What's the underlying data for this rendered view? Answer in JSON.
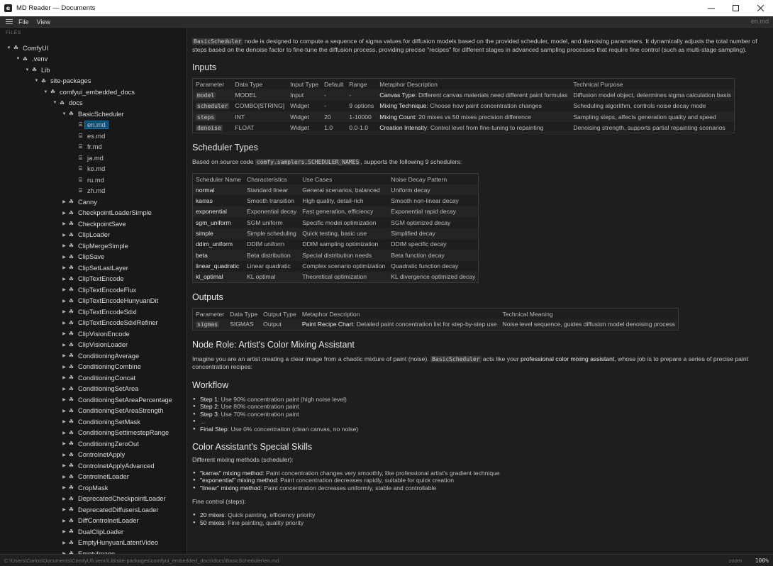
{
  "window": {
    "title": "MD Reader — Documents",
    "app_icon": "reader-app-icon"
  },
  "menu": {
    "items": [
      "File",
      "View"
    ],
    "right_label": "en.md"
  },
  "sidebar": {
    "header": "FILES",
    "tree": [
      {
        "label": "ComfyUI",
        "depth": 0,
        "type": "folder",
        "expanded": true
      },
      {
        "label": ".venv",
        "depth": 1,
        "type": "folder",
        "expanded": true
      },
      {
        "label": "Lib",
        "depth": 2,
        "type": "folder",
        "expanded": true
      },
      {
        "label": "site-packages",
        "depth": 3,
        "type": "folder",
        "expanded": true
      },
      {
        "label": "comfyui_embedded_docs",
        "depth": 4,
        "type": "folder",
        "expanded": true
      },
      {
        "label": "docs",
        "depth": 5,
        "type": "folder",
        "expanded": true
      },
      {
        "label": "BasicScheduler",
        "depth": 6,
        "type": "folder",
        "expanded": true
      },
      {
        "label": "en.md",
        "depth": 7,
        "type": "file",
        "selected": true
      },
      {
        "label": "es.md",
        "depth": 7,
        "type": "file"
      },
      {
        "label": "fr.md",
        "depth": 7,
        "type": "file"
      },
      {
        "label": "ja.md",
        "depth": 7,
        "type": "file"
      },
      {
        "label": "ko.md",
        "depth": 7,
        "type": "file"
      },
      {
        "label": "ru.md",
        "depth": 7,
        "type": "file"
      },
      {
        "label": "zh.md",
        "depth": 7,
        "type": "file"
      },
      {
        "label": "Canny",
        "depth": 6,
        "type": "folder"
      },
      {
        "label": "CheckpointLoaderSimple",
        "depth": 6,
        "type": "folder"
      },
      {
        "label": "CheckpointSave",
        "depth": 6,
        "type": "folder"
      },
      {
        "label": "ClipLoader",
        "depth": 6,
        "type": "folder"
      },
      {
        "label": "ClipMergeSimple",
        "depth": 6,
        "type": "folder"
      },
      {
        "label": "ClipSave",
        "depth": 6,
        "type": "folder"
      },
      {
        "label": "ClipSetLastLayer",
        "depth": 6,
        "type": "folder"
      },
      {
        "label": "ClipTextEncode",
        "depth": 6,
        "type": "folder"
      },
      {
        "label": "ClipTextEncodeFlux",
        "depth": 6,
        "type": "folder"
      },
      {
        "label": "ClipTextEncodeHunyuanDit",
        "depth": 6,
        "type": "folder"
      },
      {
        "label": "ClipTextEncodeSdxl",
        "depth": 6,
        "type": "folder"
      },
      {
        "label": "ClipTextEncodeSdxlRefiner",
        "depth": 6,
        "type": "folder"
      },
      {
        "label": "ClipVisionEncode",
        "depth": 6,
        "type": "folder"
      },
      {
        "label": "ClipVisionLoader",
        "depth": 6,
        "type": "folder"
      },
      {
        "label": "ConditioningAverage",
        "depth": 6,
        "type": "folder"
      },
      {
        "label": "ConditioningCombine",
        "depth": 6,
        "type": "folder"
      },
      {
        "label": "ConditioningConcat",
        "depth": 6,
        "type": "folder"
      },
      {
        "label": "ConditioningSetArea",
        "depth": 6,
        "type": "folder"
      },
      {
        "label": "ConditioningSetAreaPercentage",
        "depth": 6,
        "type": "folder"
      },
      {
        "label": "ConditioningSetAreaStrength",
        "depth": 6,
        "type": "folder"
      },
      {
        "label": "ConditioningSetMask",
        "depth": 6,
        "type": "folder"
      },
      {
        "label": "ConditioningSettimestepRange",
        "depth": 6,
        "type": "folder"
      },
      {
        "label": "ConditioningZeroOut",
        "depth": 6,
        "type": "folder"
      },
      {
        "label": "ControlnetApply",
        "depth": 6,
        "type": "folder"
      },
      {
        "label": "ControlnetApplyAdvanced",
        "depth": 6,
        "type": "folder"
      },
      {
        "label": "ControlnetLoader",
        "depth": 6,
        "type": "folder"
      },
      {
        "label": "CropMask",
        "depth": 6,
        "type": "folder"
      },
      {
        "label": "DeprecatedCheckpointLoader",
        "depth": 6,
        "type": "folder"
      },
      {
        "label": "DeprecatedDiffusersLoader",
        "depth": 6,
        "type": "folder"
      },
      {
        "label": "DiffControlnetLoader",
        "depth": 6,
        "type": "folder"
      },
      {
        "label": "DualClipLoader",
        "depth": 6,
        "type": "folder"
      },
      {
        "label": "EmptyHunyuanLatentVideo",
        "depth": 6,
        "type": "folder"
      },
      {
        "label": "EmptyImage",
        "depth": 6,
        "type": "folder"
      }
    ]
  },
  "status": {
    "path": "C:\\Users\\Carlos\\Documents\\ComfyUI\\.venv\\Lib\\site-packages\\comfyui_embedded_docs\\docs\\BasicScheduler\\en.md",
    "zoom_label": "zoom",
    "zoom": "100%"
  },
  "doc": {
    "intro": {
      "code": "BasicScheduler",
      "text": " node is designed to compute a sequence of sigma values for diffusion models based on the provided scheduler, model, and denoising parameters. It dynamically adjusts the total number of steps based on the denoise factor to fine-tune the diffusion process, providing precise \"recipes\" for different stages in advanced sampling processes that require fine control (such as multi-stage sampling)."
    },
    "inputs": {
      "heading": "Inputs",
      "headers": [
        "Parameter",
        "Data Type",
        "Input Type",
        "Default",
        "Range",
        "Metaphor Description",
        "Technical Purpose"
      ],
      "rows": [
        {
          "param": "model",
          "type": "MODEL",
          "input": "Input",
          "default": "-",
          "range": "-",
          "meta_b": "Canvas Type",
          "meta": ": Different canvas materials need different paint formulas",
          "tech": "Diffusion model object, determines sigma calculation basis"
        },
        {
          "param": "scheduler",
          "type": "COMBO[STRING]",
          "input": "Widget",
          "default": "-",
          "range": "9 options",
          "meta_b": "Mixing Technique",
          "meta": ": Choose how paint concentration changes",
          "tech": "Scheduling algorithm, controls noise decay mode"
        },
        {
          "param": "steps",
          "type": "INT",
          "input": "Widget",
          "default": "20",
          "range": "1-10000",
          "meta_b": "Mixing Count",
          "meta": ": 20 mixes vs 50 mixes precision difference",
          "tech": "Sampling steps, affects generation quality and speed"
        },
        {
          "param": "denoise",
          "type": "FLOAT",
          "input": "Widget",
          "default": "1.0",
          "range": "0.0-1.0",
          "meta_b": "Creation Intensity",
          "meta": ": Control level from fine-tuning to repainting",
          "tech": "Denoising strength, supports partial repainting scenarios"
        }
      ]
    },
    "schedulers": {
      "heading": "Scheduler Types",
      "intro_prefix": "Based on source code ",
      "intro_code": "comfy.samplers.SCHEDULER_NAMES",
      "intro_suffix": ", supports the following 9 schedulers:",
      "headers": [
        "Scheduler Name",
        "Characteristics",
        "Use Cases",
        "Noise Decay Pattern"
      ],
      "rows": [
        [
          "normal",
          "Standard linear",
          "General scenarios, balanced",
          "Uniform decay"
        ],
        [
          "karras",
          "Smooth transition",
          "High quality, detail-rich",
          "Smooth non-linear decay"
        ],
        [
          "exponential",
          "Exponential decay",
          "Fast generation, efficiency",
          "Exponential rapid decay"
        ],
        [
          "sgm_uniform",
          "SGM uniform",
          "Specific model optimization",
          "SGM optimized decay"
        ],
        [
          "simple",
          "Simple scheduling",
          "Quick testing, basic use",
          "Simplified decay"
        ],
        [
          "ddim_uniform",
          "DDIM uniform",
          "DDIM sampling optimization",
          "DDIM specific decay"
        ],
        [
          "beta",
          "Beta distribution",
          "Special distribution needs",
          "Beta function decay"
        ],
        [
          "linear_quadratic",
          "Linear quadratic",
          "Complex scenario optimization",
          "Quadratic function decay"
        ],
        [
          "kl_optimal",
          "KL optimal",
          "Theoretical optimization",
          "KL divergence optimized decay"
        ]
      ]
    },
    "outputs": {
      "heading": "Outputs",
      "headers": [
        "Parameter",
        "Data Type",
        "Output Type",
        "Metaphor Description",
        "Technical Meaning"
      ],
      "rows": [
        {
          "param": "sigmas",
          "type": "SIGMAS",
          "output": "Output",
          "meta_b": "Paint Recipe Chart",
          "meta": ": Detailed paint concentration list for step-by-step use",
          "tech": "Noise level sequence, guides diffusion model denoising process"
        }
      ]
    },
    "role": {
      "heading": "Node Role: Artist's Color Mixing Assistant",
      "p_prefix": "Imagine you are an artist creating a clear image from a chaotic mixture of paint (noise). ",
      "p_code": "BasicScheduler",
      "p_mid": " acts like your ",
      "p_bold": "professional color mixing assistant",
      "p_suffix": ", whose job is to prepare a series of precise paint concentration recipes:"
    },
    "workflow": {
      "heading": "Workflow",
      "items": [
        {
          "b": "Step 1",
          "t": ": Use 90% concentration paint (high noise level)"
        },
        {
          "b": "Step 2",
          "t": ": Use 80% concentration paint"
        },
        {
          "b": "Step 3",
          "t": ": Use 70% concentration paint"
        },
        {
          "b": "",
          "t": "..."
        },
        {
          "b": "Final Step",
          "t": ": Use 0% concentration (clean canvas, no noise)"
        }
      ]
    },
    "skills": {
      "heading": "Color Assistant's Special Skills",
      "methods_label": "Different mixing methods (scheduler):",
      "methods": [
        {
          "b": "\"karras\" mixing method",
          "t": ": Paint concentration changes very smoothly, like professional artist's gradient technique"
        },
        {
          "b": "\"exponential\" mixing method",
          "t": ": Paint concentration decreases rapidly, suitable for quick creation"
        },
        {
          "b": "\"linear\" mixing method",
          "t": ": Paint concentration decreases uniformly, stable and controllable"
        }
      ],
      "fine_label": "Fine control (steps):",
      "fine": [
        {
          "b": "20 mixes",
          "t": ": Quick painting, efficiency priority"
        },
        {
          "b": "50 mixes",
          "t": ": Fine painting, quality priority"
        }
      ]
    }
  }
}
